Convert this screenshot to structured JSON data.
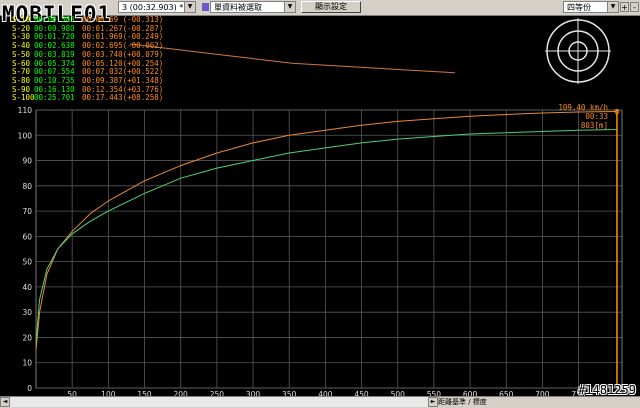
{
  "toolbar": {
    "run_select": "(00:32.903) *",
    "run_prefix": "3",
    "data_select": "單資料被選取",
    "display_button": "顯示設定",
    "mode_select": "四等份",
    "plus_label": "+",
    "minus_label": "-",
    "dropdown_glyph": "▼"
  },
  "watermark": {
    "logo_text": "MOBILE01",
    "id_text": "#1481259"
  },
  "splits": [
    {
      "label": "S-10",
      "time": "00:00.383",
      "comp": "00:00.69 (-00.313)"
    },
    {
      "label": "S-20",
      "time": "00:00.980",
      "comp": "00:01.267(-00.287)"
    },
    {
      "label": "S-30",
      "time": "00:01.720",
      "comp": "00:01.969(-00.249)"
    },
    {
      "label": "S-40",
      "time": "00:02.638",
      "comp": "00:02.695(-00.062)"
    },
    {
      "label": "S-50",
      "time": "00:03.819",
      "comp": "00:03.740(+00.079)"
    },
    {
      "label": "S-60",
      "time": "00:05.374",
      "comp": "00:05.120(+00.254)"
    },
    {
      "label": "S-70",
      "time": "00:07.554",
      "comp": "00:07.032(+00.522)"
    },
    {
      "label": "S-80",
      "time": "00:10.735",
      "comp": "00:09.387(+01.348)"
    },
    {
      "label": "S-90",
      "time": "00:16.130",
      "comp": "00:12.354(+03.776)"
    },
    {
      "label": "S-100",
      "time": "00:25.701",
      "comp": "00:17.443(+08.258)"
    }
  ],
  "readout": {
    "speed": "109.40 km/h",
    "time": "00:33",
    "distance": "803[m]"
  },
  "bottom": {
    "axis_mode_label": "距離基準 / 標度",
    "left_arrow": "◄",
    "right_arrow": "►"
  },
  "colors": {
    "orange_series": "#e8893a",
    "green_series": "#50d070",
    "grid": "#5a5a5a",
    "split_label": "#ffff00",
    "split_time": "#00ff00",
    "split_comp": "#ff8c1a"
  },
  "chart_data": {
    "type": "line",
    "xlabel": "",
    "ylabel": "",
    "xlim": [
      0,
      810
    ],
    "ylim": [
      0,
      110
    ],
    "x_ticks": [
      50,
      100,
      150,
      200,
      250,
      300,
      350,
      400,
      450,
      500,
      550,
      600,
      650,
      700,
      750
    ],
    "y_ticks": [
      0,
      10,
      20,
      30,
      40,
      50,
      60,
      70,
      80,
      90,
      100,
      110
    ],
    "grid": true,
    "legend": "none",
    "series": [
      {
        "color": "orange",
        "x": [
          0,
          5,
          15,
          30,
          50,
          75,
          100,
          150,
          200,
          250,
          300,
          350,
          400,
          450,
          500,
          550,
          600,
          650,
          700,
          750,
          803
        ],
        "y": [
          15,
          30,
          45,
          55,
          62,
          69,
          74,
          82,
          88,
          93,
          97,
          100,
          102,
          104,
          105.5,
          106.5,
          107.5,
          108.2,
          108.8,
          109.2,
          109.4
        ]
      },
      {
        "color": "green",
        "x": [
          0,
          5,
          15,
          30,
          50,
          75,
          100,
          150,
          200,
          250,
          300,
          350,
          400,
          450,
          500,
          550,
          600,
          650,
          700,
          750,
          803
        ],
        "y": [
          18,
          35,
          47,
          55,
          61,
          66,
          70,
          77,
          83,
          87,
          90,
          93,
          95,
          97,
          98.5,
          99.5,
          100.5,
          101,
          101.5,
          102,
          102.3
        ]
      }
    ]
  },
  "overview_line": {
    "x": [
      0,
      100,
      200,
      300,
      400,
      500,
      600,
      700,
      803
    ],
    "y": [
      102,
      100,
      98,
      96,
      94,
      93,
      92,
      91,
      90
    ]
  }
}
